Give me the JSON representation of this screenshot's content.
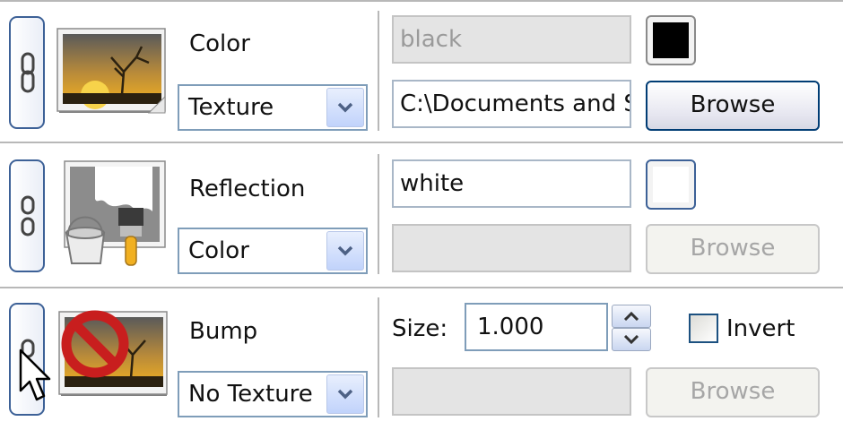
{
  "rows": [
    {
      "label": "Color",
      "source_type": "Texture",
      "color_value": "black",
      "file_path": "C:\\Documents and Settings",
      "browse_label": "Browse",
      "swatch_color": "#000000",
      "thumb_icon": "landscape-texture-icon"
    },
    {
      "label": "Reflection",
      "source_type": "Color",
      "color_value": "white",
      "file_path": "",
      "browse_label": "Browse",
      "swatch_color": "#ffffff",
      "thumb_icon": "paint-bucket-brush-icon"
    },
    {
      "label": "Bump",
      "source_type": "No Texture",
      "size_label": "Size:",
      "size_value": "1.000",
      "invert_label": "Invert",
      "invert_checked": false,
      "file_path": "",
      "browse_label": "Browse",
      "thumb_icon": "no-texture-icon"
    }
  ],
  "colors": {
    "accent_border": "#3d6197",
    "separator": "#b8b8b8",
    "disabled_field": "#e4e4e4"
  }
}
